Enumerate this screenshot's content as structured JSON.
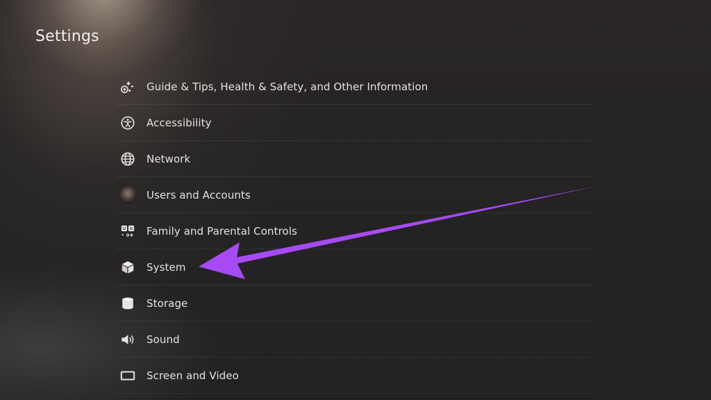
{
  "page": {
    "title": "Settings"
  },
  "settings": {
    "items": [
      {
        "label": "Guide & Tips, Health & Safety, and Other Information",
        "icon": "guide-tips-icon"
      },
      {
        "label": "Accessibility",
        "icon": "accessibility-icon"
      },
      {
        "label": "Network",
        "icon": "globe-icon"
      },
      {
        "label": "Users and Accounts",
        "icon": "user-avatar-icon"
      },
      {
        "label": "Family and Parental Controls",
        "icon": "family-controls-icon"
      },
      {
        "label": "System",
        "icon": "cube-icon"
      },
      {
        "label": "Storage",
        "icon": "cylinder-icon"
      },
      {
        "label": "Sound",
        "icon": "speaker-icon"
      },
      {
        "label": "Screen and Video",
        "icon": "screen-icon"
      }
    ]
  },
  "annotation": {
    "arrow_color": "#a64bf4",
    "points_to": "System"
  },
  "colors": {
    "text": "#e6e4e2",
    "background": "#242223",
    "divider": "rgba(255,255,255,0.07)"
  }
}
